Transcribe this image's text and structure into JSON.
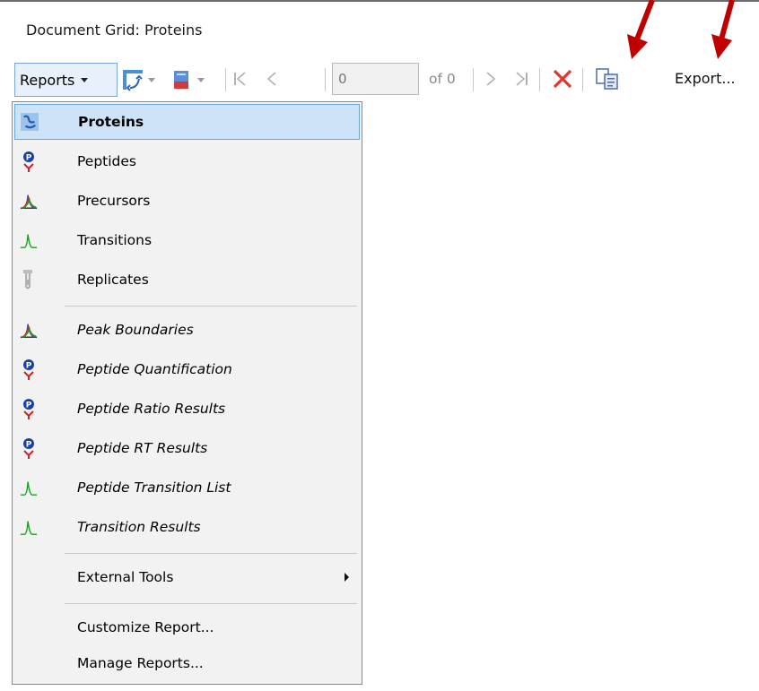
{
  "grid": {
    "title": "Document Grid: Proteins"
  },
  "toolbar": {
    "reports_label": "Reports",
    "position_value": "0",
    "of_label": "of 0",
    "export_label": "Export..."
  },
  "menu": {
    "items": [
      {
        "label": "Proteins",
        "icon": "protein-icon"
      },
      {
        "label": "Peptides",
        "icon": "peptide-icon"
      },
      {
        "label": "Precursors",
        "icon": "precursor-icon"
      },
      {
        "label": "Transitions",
        "icon": "transition-icon"
      },
      {
        "label": "Replicates",
        "icon": "replicate-icon"
      },
      {
        "label": "Peak Boundaries",
        "icon": "precursor-icon"
      },
      {
        "label": "Peptide Quantification",
        "icon": "peptide-icon"
      },
      {
        "label": "Peptide Ratio Results",
        "icon": "peptide-icon"
      },
      {
        "label": "Peptide RT Results",
        "icon": "peptide-icon"
      },
      {
        "label": "Peptide Transition List",
        "icon": "transition-icon"
      },
      {
        "label": "Transition Results",
        "icon": "transition-icon"
      },
      {
        "label": "External Tools"
      },
      {
        "label": "Customize Report..."
      },
      {
        "label": "Manage Reports..."
      }
    ]
  },
  "colors": {
    "accent_arrow": "#c00000",
    "selection_bg": "#cde3f7",
    "selection_border": "#6aa7dc"
  }
}
